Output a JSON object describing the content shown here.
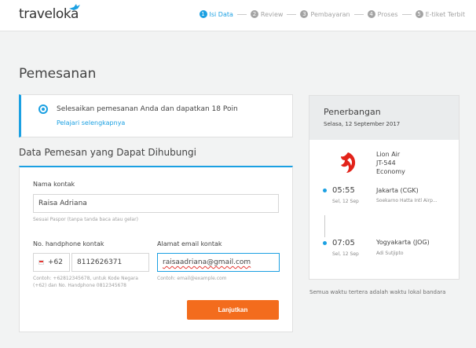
{
  "header": {
    "logo_text": "traveloka",
    "steps": [
      {
        "num": "1",
        "label": "Isi Data"
      },
      {
        "num": "2",
        "label": "Review"
      },
      {
        "num": "3",
        "label": "Pembayaran"
      },
      {
        "num": "4",
        "label": "Proses"
      },
      {
        "num": "5",
        "label": "E-tiket Terbit"
      }
    ]
  },
  "page": {
    "title": "Pemesanan"
  },
  "promo": {
    "text": "Selesaikan pemesanan Anda dan dapatkan 18 Poin",
    "link": "Pelajari selengkapnya"
  },
  "contact": {
    "section_title": "Data Pemesan yang Dapat Dihubungi",
    "name_label": "Nama kontak",
    "name_value": "Raisa Adriana",
    "name_hint": "Sesuai Paspor (tanpa tanda baca atau gelar)",
    "phone_label": "No. handphone kontak",
    "phone_prefix": "+62",
    "phone_value": "8112626371",
    "phone_hint_1": "Contoh: +62812345678, untuk Kode Negara",
    "phone_hint_2": "(+62) dan No. Handphone 0812345678",
    "email_label": "Alamat email kontak",
    "email_value": "raisaadriana@gmail.com",
    "email_hint": "Contoh: email@example.com",
    "continue_label": "Lanjutkan"
  },
  "flight": {
    "title": "Penerbangan",
    "date": "Selasa, 12 September 2017",
    "airline": "Lion Air",
    "flight_no": "JT-544",
    "cabin": "Economy",
    "depart_time": "05:55",
    "depart_day": "Sel, 12 Sep",
    "depart_city": "Jakarta (CGK)",
    "depart_airport": "Soekarno Hatta Intl Airp...",
    "arrive_time": "07:05",
    "arrive_day": "Sel, 12 Sep",
    "arrive_city": "Yogyakarta (JOG)",
    "arrive_airport": "Adi Sutjipto",
    "tz_note": "Semua waktu tertera adalah waktu lokal bandara"
  },
  "colors": {
    "accent": "#1ba0e2",
    "cta": "#f36c1d",
    "airline_red": "#e2231a"
  }
}
